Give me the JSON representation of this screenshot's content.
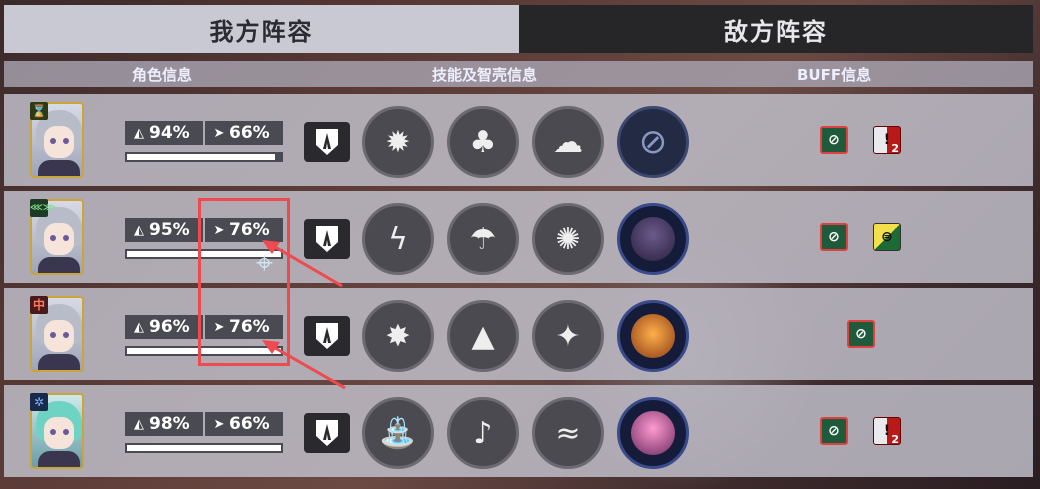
{
  "tabs": {
    "ally": "我方阵容",
    "enemy": "敌方阵容"
  },
  "headers": {
    "role": "角色信息",
    "skill": "技能及智壳信息",
    "buff": "BUFF信息"
  },
  "colors": {
    "accent_red": "#ee4a50",
    "ally_tab_bg": "#c9c9d3",
    "enemy_tab_bg": "#262628"
  },
  "rows": [
    {
      "role_icon": "⌛",
      "hp": "94%",
      "sp": "66%",
      "bar_fill": 0.96,
      "skills": [
        "burst-skill-icon",
        "clover-skill-icon",
        "cloud-skill-icon",
        "none-icon"
      ],
      "buffs": [
        {
          "type": "green",
          "label": "⊘"
        },
        {
          "type": "red",
          "label": "!",
          "count": "2"
        }
      ]
    },
    {
      "role_icon": "⋘⋙",
      "hp": "95%",
      "sp": "76%",
      "bar_fill": 1.0,
      "skills": [
        "lightning-skill-icon",
        "umbrella-skill-icon",
        "crab-skill-icon",
        "character-purple-icon"
      ],
      "buffs": [
        {
          "type": "green",
          "label": "⊘"
        },
        {
          "type": "yellow",
          "label": "⊜"
        }
      ]
    },
    {
      "role_icon": "中",
      "hp": "96%",
      "sp": "76%",
      "bar_fill": 1.0,
      "skills": [
        "explosion-skill-icon",
        "mountain-skill-icon",
        "spark-skill-icon",
        "character-orange-icon"
      ],
      "buffs": [
        {
          "type": "green",
          "label": "⊘"
        }
      ]
    },
    {
      "role_icon": "✲",
      "hp": "98%",
      "sp": "66%",
      "bar_fill": 1.0,
      "skills": [
        "fountain-skill-icon",
        "music-skill-icon",
        "whale-skill-icon",
        "character-pink-icon"
      ],
      "buffs": [
        {
          "type": "green",
          "label": "⊘"
        },
        {
          "type": "red",
          "label": "!",
          "count": "2"
        }
      ]
    }
  ]
}
